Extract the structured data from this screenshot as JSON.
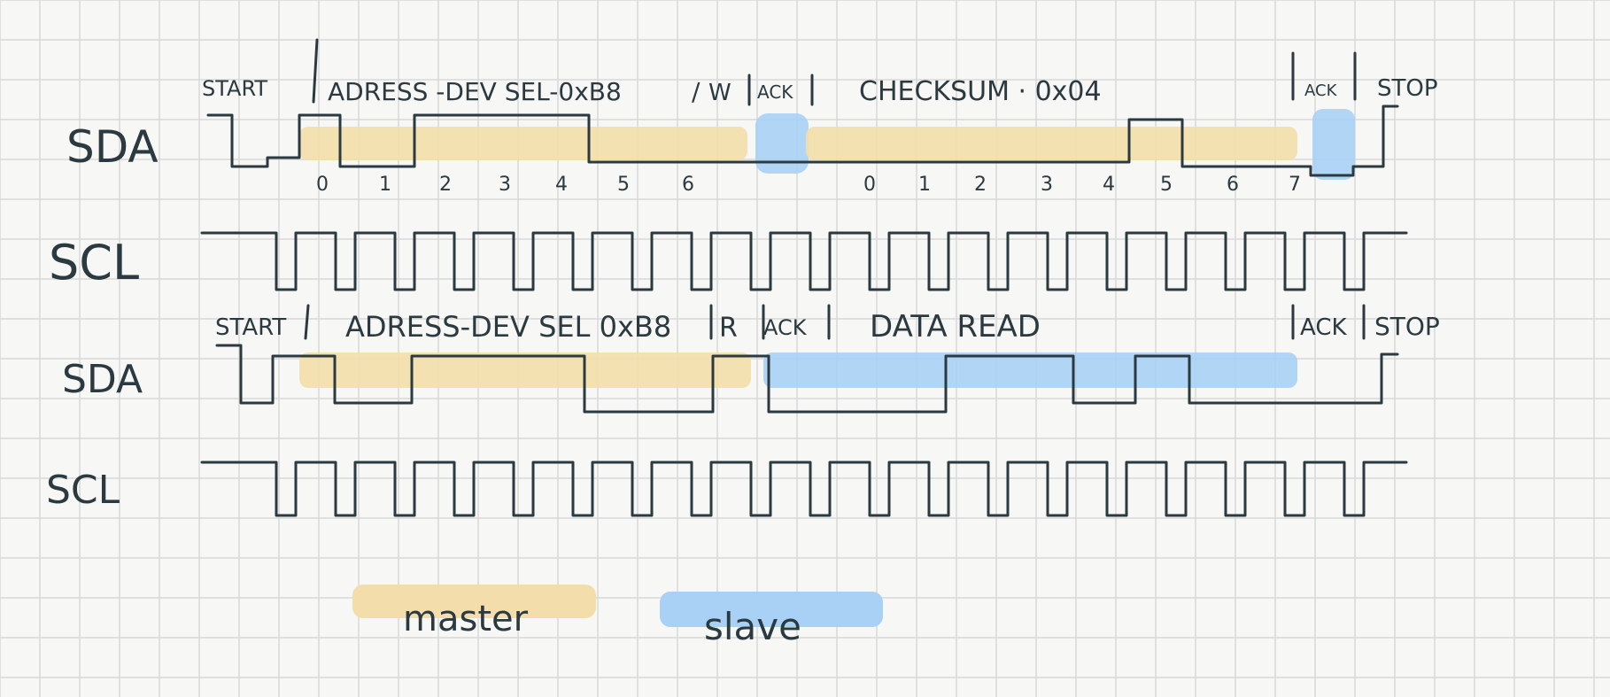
{
  "colors": {
    "master": "#f3deab",
    "slave": "#a9d0f5",
    "ink": "#2b3a40",
    "grid": "#d9d9d9"
  },
  "rows": {
    "write": {
      "sda_label": "SDA",
      "scl_label": "SCL",
      "fields": {
        "start": "START",
        "address": "ADRESS -DEV SEL-0xB8",
        "rw": "W",
        "ack1": "ACK",
        "data": "CHECKSUM · 0x04",
        "ack2": "ACK",
        "stop": "STOP"
      },
      "bit_indices": [
        "0",
        "1",
        "2",
        "3",
        "4",
        "5",
        "6",
        "0",
        "1",
        "2",
        "3",
        "4",
        "5",
        "6",
        "7"
      ]
    },
    "read": {
      "sda_label": "SDA",
      "scl_label": "SCL",
      "fields": {
        "start": "START",
        "address": "ADRESS-DEV SEL 0xB8",
        "rw": "R",
        "ack1": "ACK",
        "data": "DATA READ",
        "ack2": "ACK",
        "stop": "STOP"
      }
    }
  },
  "legend": {
    "master": "master",
    "slave": "slave"
  }
}
